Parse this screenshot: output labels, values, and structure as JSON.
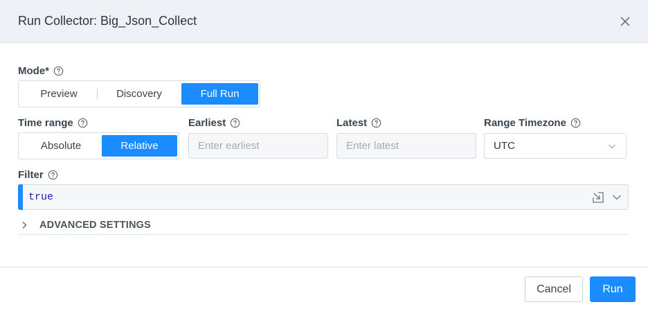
{
  "dialog": {
    "title": "Run Collector: Big_Json_Collect"
  },
  "mode": {
    "label": "Mode*",
    "options": [
      "Preview",
      "Discovery",
      "Full Run"
    ],
    "selected": "Full Run"
  },
  "time_range": {
    "label": "Time range",
    "options": [
      "Absolute",
      "Relative"
    ],
    "selected": "Relative"
  },
  "earliest": {
    "label": "Earliest",
    "placeholder": "Enter earliest",
    "value": ""
  },
  "latest": {
    "label": "Latest",
    "placeholder": "Enter latest",
    "value": ""
  },
  "range_timezone": {
    "label": "Range Timezone",
    "value": "UTC"
  },
  "filter": {
    "label": "Filter",
    "value": "true"
  },
  "advanced": {
    "label": "ADVANCED SETTINGS"
  },
  "footer": {
    "cancel_label": "Cancel",
    "run_label": "Run"
  },
  "colors": {
    "accent": "#1a8cff",
    "header_bg": "#eef1f6",
    "code_text": "#1e1ea8"
  },
  "icons": [
    "close-icon",
    "help-icon",
    "chevron-down-icon",
    "expand-editor-icon",
    "chevron-right-icon"
  ]
}
